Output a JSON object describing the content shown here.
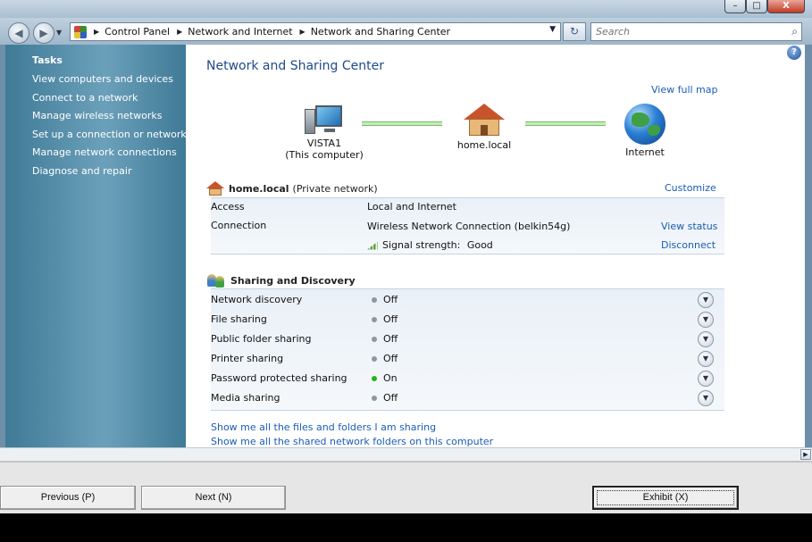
{
  "window": {
    "controls": {
      "minimize": "–",
      "maximize": "□",
      "close": "X"
    }
  },
  "addressbar": {
    "back_icon": "back-arrow-icon",
    "forward_icon": "forward-arrow-icon",
    "breadcrumbs": [
      "Control Panel",
      "Network and Internet",
      "Network and Sharing Center"
    ],
    "search_placeholder": "Search"
  },
  "sidebar": {
    "heading": "Tasks",
    "items": [
      "View computers and devices",
      "Connect to a network",
      "Manage wireless networks",
      "Set up a connection or network",
      "Manage network connections",
      "Diagnose and repair"
    ]
  },
  "main": {
    "title": "Network and Sharing Center",
    "view_full_map": "View full map",
    "map": {
      "computer_name": "VISTA1",
      "computer_sub": "(This computer)",
      "network_name": "home.local",
      "internet_name": "Internet"
    },
    "network": {
      "name": "home.local",
      "type": "(Private network)",
      "customize": "Customize",
      "access_label": "Access",
      "access_value": "Local and Internet",
      "connection_label": "Connection",
      "connection_value": "Wireless Network Connection (belkin54g)",
      "view_status": "View status",
      "signal_label": "Signal strength:",
      "signal_value": "Good",
      "disconnect": "Disconnect"
    },
    "sharing": {
      "title": "Sharing and Discovery",
      "rows": [
        {
          "label": "Network discovery",
          "status": "Off",
          "on": false
        },
        {
          "label": "File sharing",
          "status": "Off",
          "on": false
        },
        {
          "label": "Public folder sharing",
          "status": "Off",
          "on": false
        },
        {
          "label": "Printer sharing",
          "status": "Off",
          "on": false
        },
        {
          "label": "Password protected sharing",
          "status": "On",
          "on": true
        },
        {
          "label": "Media sharing",
          "status": "Off",
          "on": false
        }
      ]
    },
    "links": [
      "Show me all the files and folders I am sharing",
      "Show me all the shared network folders on this computer"
    ]
  },
  "footer": {
    "previous": "Previous (P)",
    "next": "Next (N)",
    "exhibit": "Exhibit (X)"
  },
  "colors": {
    "link": "#1a5cb5",
    "title": "#1e4a8c",
    "sidebar": "#4f88a4",
    "status_on": "#1fb51f",
    "status_off": "#8e969e"
  }
}
